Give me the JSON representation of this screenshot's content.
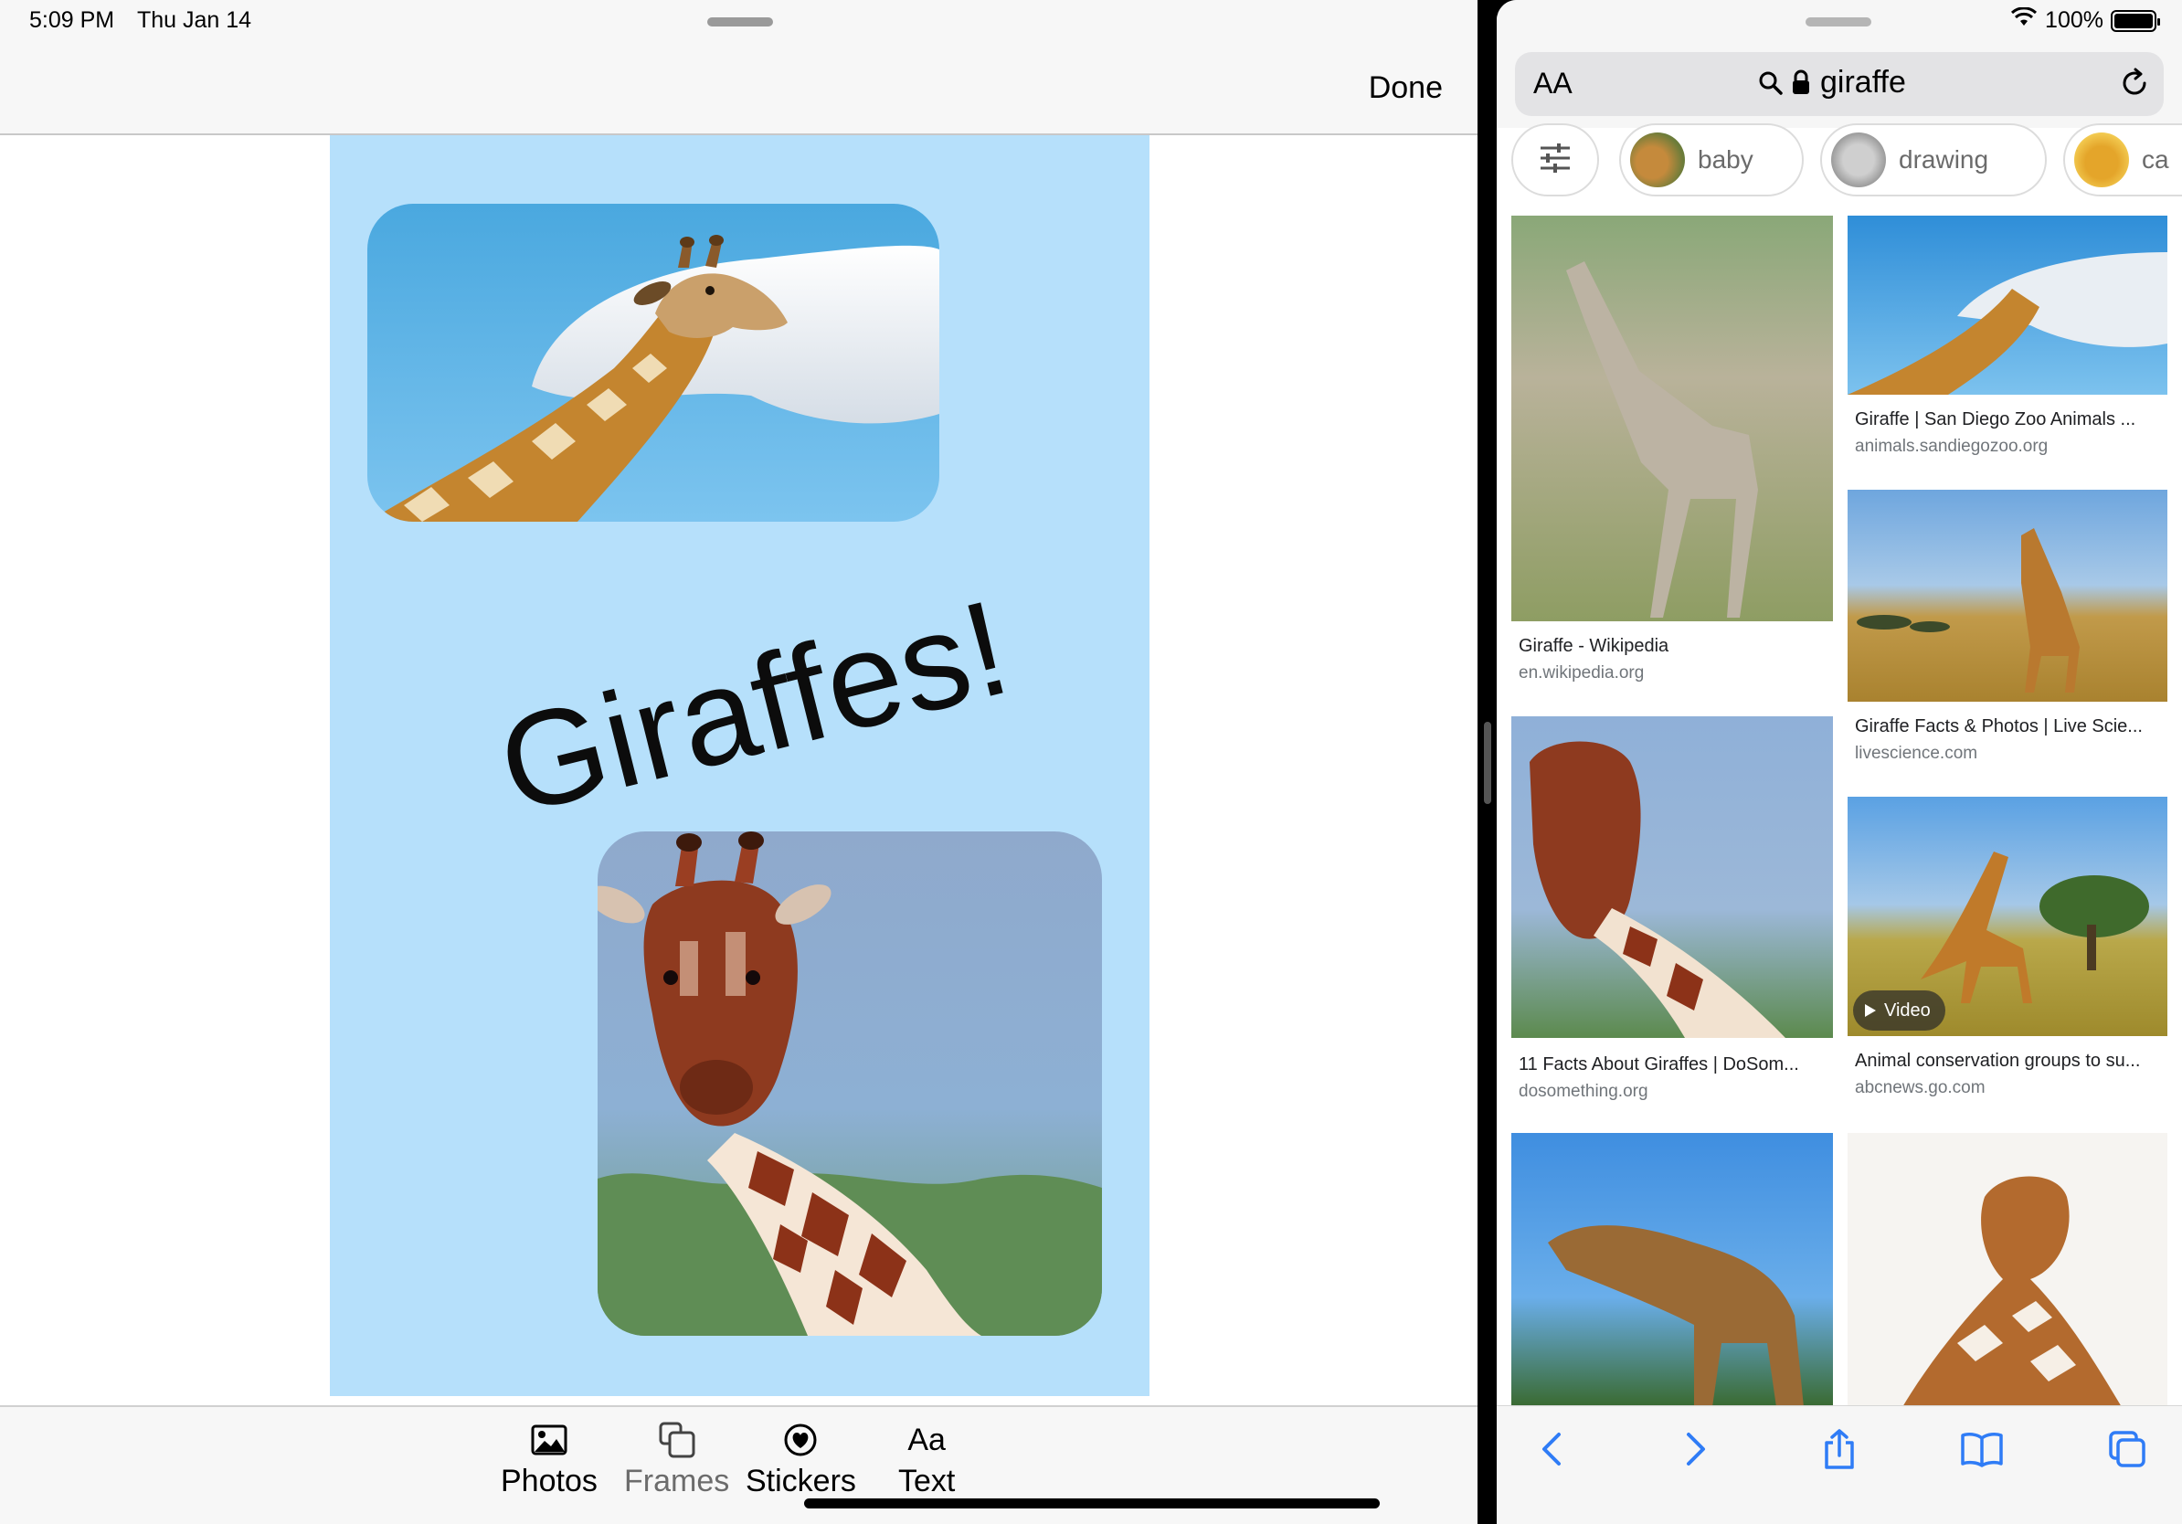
{
  "status_bar": {
    "time": "5:09 PM",
    "date": "Thu Jan 14",
    "battery": "100%"
  },
  "editor": {
    "done_label": "Done",
    "sticker_text": "Giraffes!",
    "toolbar": {
      "photos": "Photos",
      "frames": "Frames",
      "stickers": "Stickers",
      "text_icon": "Aa",
      "text": "Text"
    }
  },
  "safari": {
    "text_size_label": "AA",
    "url_text": "giraffe",
    "chips": [
      "baby",
      "drawing",
      "ca"
    ],
    "results": [
      {
        "title": "Giraffe - Wikipedia",
        "domain": "en.wikipedia.org"
      },
      {
        "title": "Giraffe | San Diego Zoo Animals ...",
        "domain": "animals.sandiegozoo.org"
      },
      {
        "title": "Giraffe Facts & Photos | Live Scie...",
        "domain": "livescience.com"
      },
      {
        "title": "11 Facts About Giraffes | DoSom...",
        "domain": "dosomething.org"
      },
      {
        "title": "Animal conservation groups to su...",
        "domain": "abcnews.go.com",
        "badge": "Video"
      }
    ]
  },
  "icons": {
    "photos": "photo-icon",
    "frames": "frames-icon",
    "stickers": "sticker-icon",
    "search": "magnifier-icon",
    "lock": "lock-icon",
    "reload": "reload-icon",
    "filter": "sliders-icon",
    "back": "chevron-left-icon",
    "forward": "chevron-right-icon",
    "share": "share-icon",
    "bookmarks": "book-icon",
    "tabs": "tabs-icon"
  },
  "colors": {
    "canvas_bg": "#b6e0fb",
    "safari_accent": "#2f7cf6"
  }
}
